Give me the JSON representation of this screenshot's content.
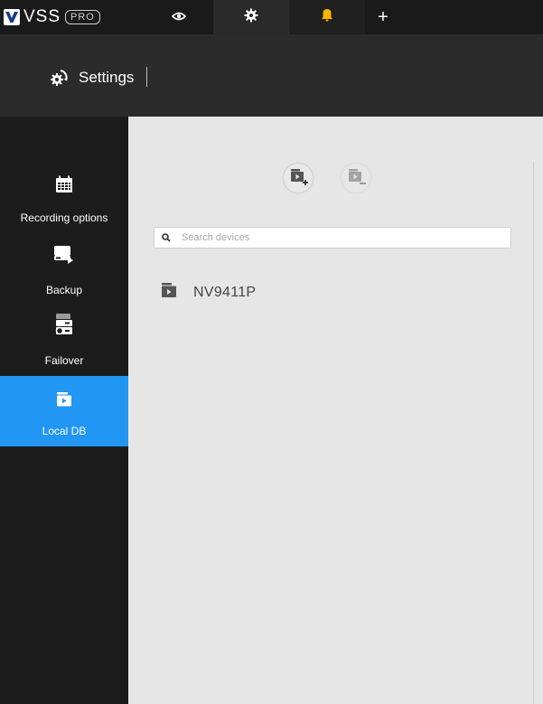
{
  "app": {
    "logo_text": "VSS",
    "logo_badge": "PRO"
  },
  "topbar": {
    "tabs": [
      {
        "icon": "eye-icon"
      },
      {
        "icon": "gear-icon"
      },
      {
        "icon": "bell-icon",
        "color": "#f5b800"
      },
      {
        "icon": "plus-icon",
        "label": "+"
      }
    ]
  },
  "header": {
    "title": "Settings"
  },
  "sidebar": {
    "items": [
      {
        "label": "Recording options",
        "icon": "calendar-icon"
      },
      {
        "label": "Backup",
        "icon": "backup-icon"
      },
      {
        "label": "Failover",
        "icon": "failover-icon"
      },
      {
        "label": "Local DB",
        "icon": "local-db-icon",
        "active": true
      }
    ],
    "active_color": "#2196f3"
  },
  "main": {
    "search": {
      "placeholder": "Search devices",
      "value": ""
    },
    "devices": [
      {
        "name": "NV9411P",
        "icon": "folder-video-icon"
      }
    ]
  }
}
